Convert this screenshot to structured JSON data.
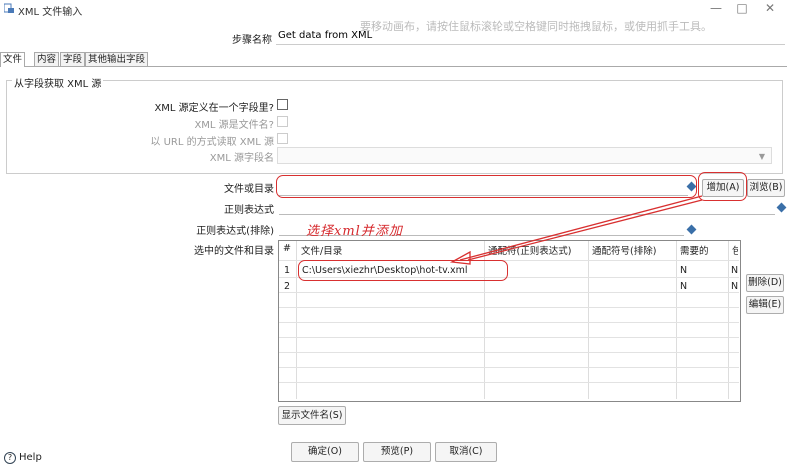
{
  "window": {
    "title": "XML 文件输入",
    "minimize": "—",
    "maximize": "□",
    "close": "✕"
  },
  "tip": "要移动画布，请按住鼠标滚轮或空格键同时拖拽鼠标，或使用抓手工具。",
  "step": {
    "label": "步骤名称",
    "value": "Get data from XML"
  },
  "tabs": [
    {
      "label": "文件"
    },
    {
      "label": "内容"
    },
    {
      "label": "字段"
    },
    {
      "label": "其他输出字段"
    }
  ],
  "group": {
    "title": "从字段获取 XML 源",
    "xml_in_field": "XML 源定义在一个字段里?",
    "xml_is_filename": "XML 源是文件名?",
    "read_url": "以 URL 的方式读取 XML 源",
    "xml_field_name": "XML 源字段名"
  },
  "file_or_dir": {
    "label": "文件或目录",
    "value": ""
  },
  "regex": {
    "label": "正则表达式"
  },
  "regex_exclude": {
    "label": "正则表达式(排除)"
  },
  "buttons": {
    "add": "增加(A)",
    "browse": "浏览(B)",
    "delete": "删除(D)",
    "edit": "编辑(E)",
    "show_filenames": "显示文件名(S)",
    "ok": "确定(O)",
    "preview": "预览(P)",
    "cancel": "取消(C)"
  },
  "selected": {
    "label": "选中的文件和目录",
    "columns": [
      "#",
      "文件/目录",
      "通配符(正则表达式)",
      "通配符号(排除)",
      "需要的",
      "包"
    ],
    "rows": [
      {
        "num": "1",
        "path": "C:\\Users\\xiezhr\\Desktop\\hot-tv.xml",
        "wildcard": "",
        "exclude": "",
        "required": "N",
        "sub": "N"
      },
      {
        "num": "2",
        "path": "",
        "wildcard": "",
        "exclude": "",
        "required": "N",
        "sub": "N"
      }
    ]
  },
  "annotation": "选择xml并添加",
  "help": "Help",
  "colors": {
    "annotation": "#d83030",
    "link_icon": "#3a6fa8"
  }
}
